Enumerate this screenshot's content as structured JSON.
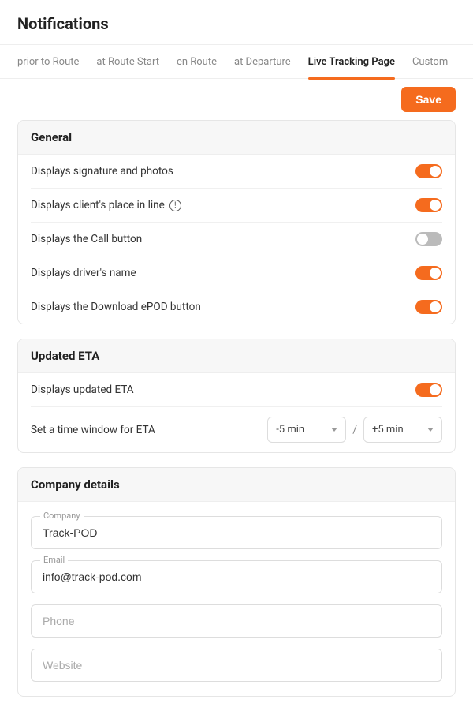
{
  "header": {
    "title": "Notifications"
  },
  "tabs": [
    {
      "label": "prior to Route",
      "active": false
    },
    {
      "label": "at Route Start",
      "active": false
    },
    {
      "label": "en Route",
      "active": false
    },
    {
      "label": "at Departure",
      "active": false
    },
    {
      "label": "Live Tracking Page",
      "active": true
    },
    {
      "label": "Custom",
      "active": false
    }
  ],
  "save_label": "Save",
  "sections": {
    "general": {
      "title": "General",
      "items": [
        {
          "label": "Displays signature and photos",
          "on": true,
          "info": false
        },
        {
          "label": "Displays client's place in line",
          "on": true,
          "info": true
        },
        {
          "label": "Displays the Call button",
          "on": false,
          "info": false
        },
        {
          "label": "Displays driver's name",
          "on": true,
          "info": false
        },
        {
          "label": "Displays the Download ePOD button",
          "on": true,
          "info": false
        }
      ]
    },
    "eta": {
      "title": "Updated ETA",
      "toggle_label": "Displays updated ETA",
      "toggle_on": true,
      "window_label": "Set a time window for ETA",
      "lower": "-5 min",
      "separator": "/",
      "upper": "+5 min"
    },
    "company": {
      "title": "Company details",
      "company_label": "Company",
      "company_value": "Track-POD",
      "email_label": "Email",
      "email_value": "info@track-pod.com",
      "phone_placeholder": "Phone",
      "phone_value": "",
      "website_placeholder": "Website",
      "website_value": ""
    }
  },
  "info_glyph": "!"
}
